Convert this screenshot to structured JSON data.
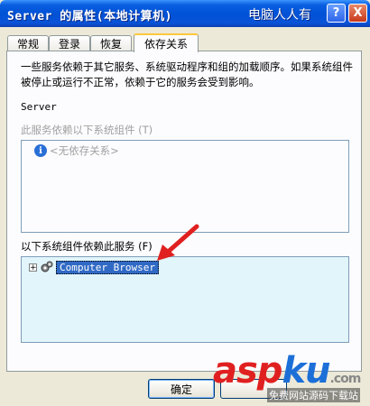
{
  "window": {
    "title": "Server 的属性(本地计算机)",
    "watermark": "电脑人人有",
    "help_glyph": "?",
    "close_glyph": "X"
  },
  "tabs": [
    {
      "label": "常规"
    },
    {
      "label": "登录"
    },
    {
      "label": "恢复"
    },
    {
      "label": "依存关系",
      "active": true
    }
  ],
  "panel": {
    "description": "一些服务依赖于其它服务、系统驱动程序和组的加载顺序。如果系统组件被停止或运行不正常，依赖于它的服务会受到影响。",
    "service_name": "Server",
    "depends_on_label": "此服务依赖以下系统组件 (T)",
    "depends_on_items": [
      "<无依存关系>"
    ],
    "dependents_label": "以下系统组件依赖此服务 (F)",
    "dependents_items": [
      "Computer Browser"
    ]
  },
  "buttons": {
    "ok": "确定"
  },
  "site_watermark": {
    "logo_a": "asp",
    "logo_b": "ku",
    "logo_c": ".com",
    "sub": "免费网站源码下载站"
  }
}
